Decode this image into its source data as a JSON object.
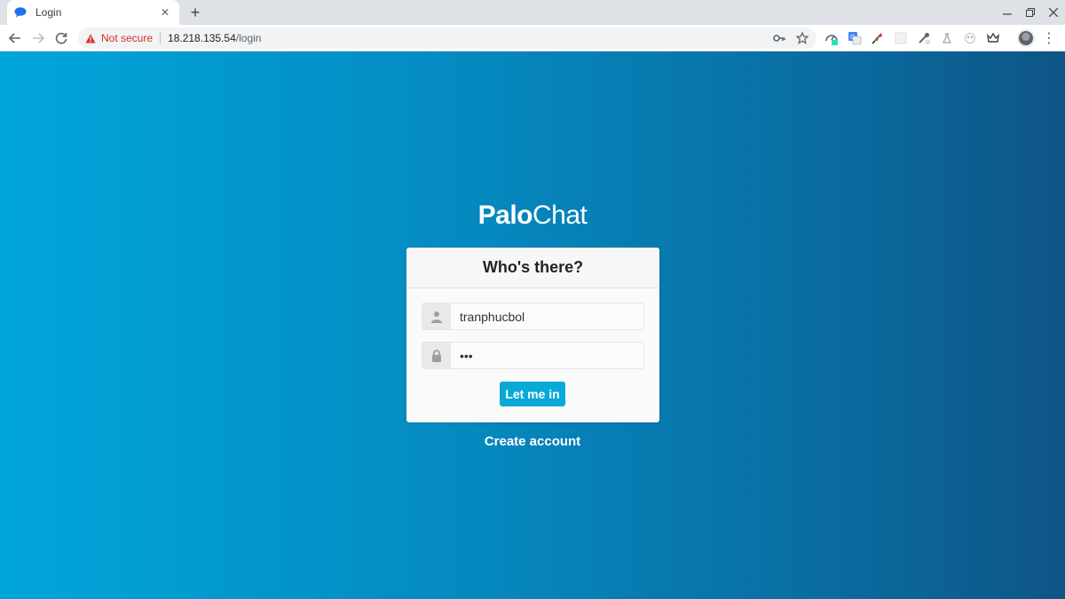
{
  "browser": {
    "tab": {
      "title": "Login",
      "favicon": "chat-bubble-icon"
    },
    "security_label": "Not secure",
    "url_host": "18.218.135.54",
    "url_path": "/login"
  },
  "page": {
    "brand_bold": "Palo",
    "brand_light": "Chat",
    "card_title": "Who's there?",
    "username": {
      "value": "tranphucbol",
      "icon": "user-icon"
    },
    "password": {
      "value": "•••",
      "icon": "lock-icon"
    },
    "submit_label": "Let me in",
    "create_account_label": "Create account"
  },
  "colors": {
    "accent": "#08a9d6",
    "gradient_left": "#00a6db",
    "gradient_right": "#0e5586",
    "warning_red": "#d93025"
  }
}
